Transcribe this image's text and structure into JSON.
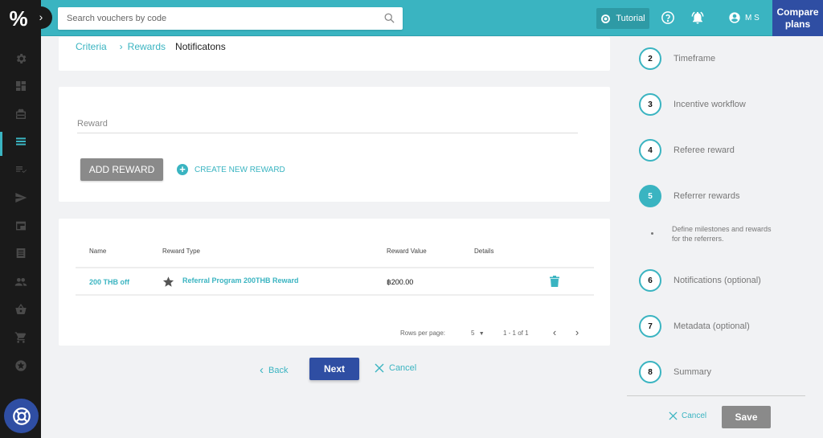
{
  "topbar": {
    "search_placeholder": "Search vouchers by code",
    "tutorial_label": "Tutorial",
    "user_initials": "M S",
    "compare_label_line1": "Compare",
    "compare_label_line2": "plans",
    "accent_color": "#3ab4c1",
    "brand_blue": "#2f4ea3"
  },
  "sidebar": {
    "logo": "%",
    "items": [
      {
        "icon": "gear-icon"
      },
      {
        "icon": "dashboard-icon"
      },
      {
        "icon": "gift-icon"
      },
      {
        "icon": "list-icon",
        "active": true
      },
      {
        "icon": "checklist-icon"
      },
      {
        "icon": "send-icon"
      },
      {
        "icon": "browser-window-icon"
      },
      {
        "icon": "document-icon"
      },
      {
        "icon": "people-icon"
      },
      {
        "icon": "basket-icon"
      },
      {
        "icon": "cart-icon"
      },
      {
        "icon": "star-circle-icon"
      }
    ],
    "help_icon": "lifebuoy-icon"
  },
  "breadcrumb": {
    "items": [
      "Criteria",
      "Rewards"
    ],
    "current": "Notificatons"
  },
  "reward_form": {
    "field_label": "Reward",
    "add_button": "ADD REWARD",
    "create_link": "CREATE NEW REWARD"
  },
  "rewards_table": {
    "columns": [
      "Name",
      "Reward Type",
      "Reward Value",
      "Details"
    ],
    "rows": [
      {
        "name": "200 THB off",
        "type": "Referral Program 200THB Reward",
        "value": "฿200.00",
        "details": ""
      }
    ],
    "pagination": {
      "rows_per_page_label": "Rows per page:",
      "rows_per_page": "5",
      "range": "1 - 1 of 1"
    }
  },
  "footer_nav": {
    "back": "Back",
    "next": "Next",
    "cancel": "Cancel"
  },
  "stepper": {
    "steps": [
      {
        "number": "2",
        "label": "Timeframe"
      },
      {
        "number": "3",
        "label": "Incentive workflow"
      },
      {
        "number": "4",
        "label": "Referee reward"
      },
      {
        "number": "5",
        "label": "Referrer rewards",
        "active": true
      },
      {
        "number": "6",
        "label": "Notifications (optional)"
      },
      {
        "number": "7",
        "label": "Metadata (optional)"
      },
      {
        "number": "8",
        "label": "Summary"
      }
    ],
    "active_description_line1": "Define milestones and rewards",
    "active_description_line2": "for the referrers.",
    "cancel": "Cancel",
    "save": "Save"
  }
}
